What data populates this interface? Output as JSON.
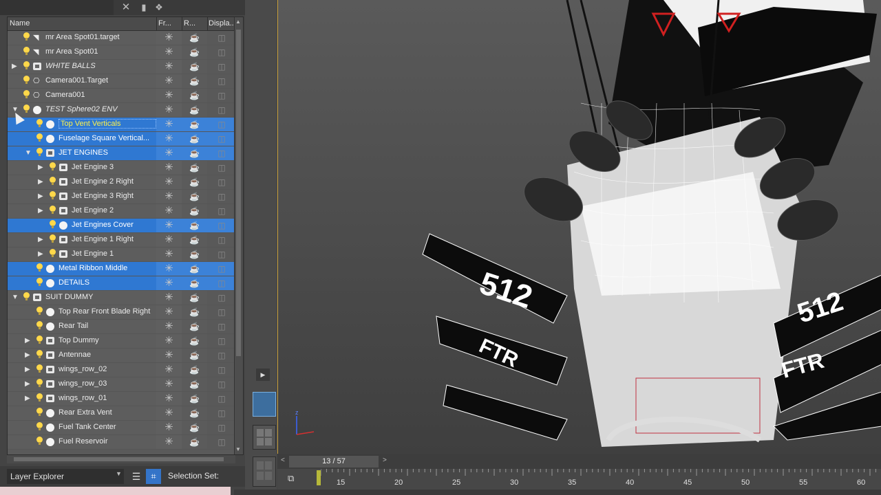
{
  "toolbar": {
    "close_glyph": "✕"
  },
  "columns": {
    "name": "Name",
    "frozen": "Fr...",
    "render": "R...",
    "display": "Displa..."
  },
  "rows": [
    {
      "label": "mr Area Spot01.target",
      "indent": 0,
      "icon": "light-target",
      "italic": false,
      "selected": false,
      "expander": ""
    },
    {
      "label": "mr Area Spot01",
      "indent": 0,
      "icon": "light",
      "italic": false,
      "selected": false,
      "expander": ""
    },
    {
      "label": "WHITE BALLS",
      "indent": 0,
      "icon": "layer",
      "italic": true,
      "selected": false,
      "expander": "▶"
    },
    {
      "label": "Camera001.Target",
      "indent": 0,
      "icon": "camera",
      "italic": false,
      "selected": false,
      "expander": ""
    },
    {
      "label": "Camera001",
      "indent": 0,
      "icon": "camera",
      "italic": false,
      "selected": false,
      "expander": ""
    },
    {
      "label": "TEST Sphere02 ENV",
      "indent": 0,
      "icon": "object",
      "italic": true,
      "selected": false,
      "expander": "▼"
    },
    {
      "label": "Top Vent Verticals",
      "indent": 1,
      "icon": "object",
      "italic": false,
      "selected": true,
      "expander": "",
      "boxed": true
    },
    {
      "label": "Fuselage Square Vertical...",
      "indent": 1,
      "icon": "object",
      "italic": false,
      "selected": true,
      "expander": ""
    },
    {
      "label": "JET ENGINES",
      "indent": 1,
      "icon": "layer",
      "italic": false,
      "selected": true,
      "expander": "▼"
    },
    {
      "label": "Jet Engine 3",
      "indent": 2,
      "icon": "layer",
      "italic": false,
      "selected": false,
      "expander": "▶"
    },
    {
      "label": "Jet Engine 2 Right",
      "indent": 2,
      "icon": "layer",
      "italic": false,
      "selected": false,
      "expander": "▶"
    },
    {
      "label": "Jet Engine 3 Right",
      "indent": 2,
      "icon": "layer",
      "italic": false,
      "selected": false,
      "expander": "▶"
    },
    {
      "label": "Jet Engine 2",
      "indent": 2,
      "icon": "layer",
      "italic": false,
      "selected": false,
      "expander": "▶"
    },
    {
      "label": "Jet Engines Cover",
      "indent": 2,
      "icon": "object",
      "italic": false,
      "selected": true,
      "expander": ""
    },
    {
      "label": "Jet Engine 1 Right",
      "indent": 2,
      "icon": "layer",
      "italic": false,
      "selected": false,
      "expander": "▶"
    },
    {
      "label": "Jet Engine 1",
      "indent": 2,
      "icon": "layer",
      "italic": false,
      "selected": false,
      "expander": "▶"
    },
    {
      "label": "Metal Ribbon Middle",
      "indent": 1,
      "icon": "object",
      "italic": false,
      "selected": true,
      "expander": ""
    },
    {
      "label": "DETAILS",
      "indent": 1,
      "icon": "object",
      "italic": false,
      "selected": true,
      "expander": ""
    },
    {
      "label": "SUIT DUMMY",
      "indent": 0,
      "icon": "layer",
      "italic": false,
      "selected": false,
      "expander": "▼"
    },
    {
      "label": "Top Rear Front Blade Right",
      "indent": 1,
      "icon": "object",
      "italic": false,
      "selected": false,
      "expander": ""
    },
    {
      "label": "Rear Tail",
      "indent": 1,
      "icon": "object",
      "italic": false,
      "selected": false,
      "expander": ""
    },
    {
      "label": "Top Dummy",
      "indent": 1,
      "icon": "layer",
      "italic": false,
      "selected": false,
      "expander": "▶"
    },
    {
      "label": "Antennae",
      "indent": 1,
      "icon": "layer",
      "italic": false,
      "selected": false,
      "expander": "▶"
    },
    {
      "label": "wings_row_02",
      "indent": 1,
      "icon": "layer",
      "italic": false,
      "selected": false,
      "expander": "▶"
    },
    {
      "label": "wings_row_03",
      "indent": 1,
      "icon": "layer",
      "italic": false,
      "selected": false,
      "expander": "▶"
    },
    {
      "label": "wings_row_01",
      "indent": 1,
      "icon": "layer",
      "italic": false,
      "selected": false,
      "expander": "▶"
    },
    {
      "label": "Rear Extra Vent",
      "indent": 1,
      "icon": "object",
      "italic": false,
      "selected": false,
      "expander": ""
    },
    {
      "label": "Fuel Tank Center",
      "indent": 1,
      "icon": "object",
      "italic": false,
      "selected": false,
      "expander": ""
    },
    {
      "label": "Fuel Reservoir",
      "indent": 1,
      "icon": "object",
      "italic": false,
      "selected": false,
      "expander": ""
    }
  ],
  "glyphs": {
    "freeze": "✳",
    "render": "☕",
    "display": "◫"
  },
  "footer": {
    "explorer_type": "Layer Explorer",
    "selection_set": "Selection Set:"
  },
  "timeline": {
    "frame": "13 / 57",
    "ticks": [
      "15",
      "20",
      "25",
      "30",
      "35",
      "40",
      "45",
      "50",
      "55",
      "60"
    ]
  },
  "viewport": {
    "decals": [
      "512",
      "512",
      "FTR",
      "FTR"
    ]
  },
  "colors": {
    "selection": "#2f78d2",
    "highlight_text": "#fff24a",
    "viewport_border": "#c9a03c"
  }
}
